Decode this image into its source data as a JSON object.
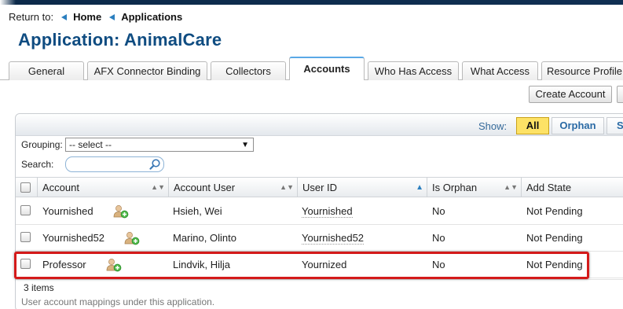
{
  "breadcrumb": {
    "return_label": "Return to:",
    "items": [
      "Home",
      "Applications"
    ]
  },
  "page_title": "Application: AnimalCare",
  "tabs": [
    {
      "label": "General"
    },
    {
      "label": "AFX Connector Binding"
    },
    {
      "label": "Collectors"
    },
    {
      "label": "Accounts",
      "active": true
    },
    {
      "label": "Who Has Access"
    },
    {
      "label": "What Access"
    },
    {
      "label": "Resource Profile"
    }
  ],
  "toolbar": {
    "create_account_label": "Create Account"
  },
  "show": {
    "label": "Show:",
    "filters": [
      "All",
      "Orphan",
      "S"
    ],
    "selected": "All"
  },
  "grouping": {
    "label": "Grouping:",
    "value": "-- select --"
  },
  "search": {
    "label": "Search:",
    "value": ""
  },
  "table": {
    "columns": [
      "Account",
      "Account User",
      "User ID",
      "Is Orphan",
      "Add State"
    ],
    "sorted_column": "User ID",
    "sort_direction": "ascending",
    "rows": [
      {
        "account": "Yournished",
        "account_user": "Hsieh, Wei",
        "user_id": "Yournished",
        "is_orphan": "No",
        "add_state": "Not Pending"
      },
      {
        "account": "Yournished52",
        "account_user": "Marino, Olinto",
        "user_id": "Yournished52",
        "is_orphan": "No",
        "add_state": "Not Pending"
      },
      {
        "account": "Professor",
        "account_user": "Lindvik, Hilja",
        "user_id": "Yournized",
        "is_orphan": "No",
        "add_state": "Not Pending",
        "highlighted": true
      }
    ]
  },
  "footer": {
    "count": "3 items",
    "description": "User account mappings under this application."
  },
  "colors": {
    "title": "#0f4c81",
    "selected_filter": "#fde266",
    "highlight_border": "#d41a1a",
    "accent": "#2b7fbf"
  },
  "icons": [
    "breadcrumb-arrow-icon",
    "search-icon",
    "sort-icon",
    "add-user-icon",
    "dropdown-arrow-icon"
  ]
}
